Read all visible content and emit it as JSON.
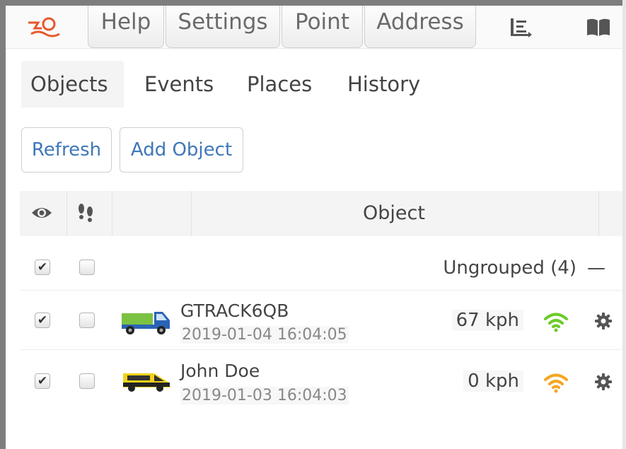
{
  "toolbar": {
    "logo_icon": "app-logo-icon",
    "buttons": [
      {
        "label": "Help"
      },
      {
        "label": "Settings"
      },
      {
        "label": "Point"
      },
      {
        "label": "Address"
      }
    ],
    "list_icon": "list-icon",
    "book_icon": "book-icon"
  },
  "tabs": [
    {
      "label": "Objects",
      "active": true
    },
    {
      "label": "Events"
    },
    {
      "label": "Places"
    },
    {
      "label": "History"
    }
  ],
  "actions": {
    "refresh_label": "Refresh",
    "add_object_label": "Add Object"
  },
  "table": {
    "visibility_icon": "eye-icon",
    "follow_icon": "footprints-icon",
    "object_header": "Object"
  },
  "group": {
    "label": "Ungrouped (4)",
    "collapse_symbol": "—",
    "visible_checked": true,
    "follow_checked": false
  },
  "objects": [
    {
      "name": "GTRACK6QB",
      "timestamp": "2019-01-04 16:04:05",
      "speed": "67 kph",
      "vehicle_icon": "truck-icon",
      "signal_icon": "wifi-signal-icon",
      "signal_color": "#6ccb2a",
      "visible_checked": true,
      "follow_checked": false
    },
    {
      "name": "John Doe",
      "timestamp": "2019-01-03 16:04:03",
      "speed": "0 kph",
      "vehicle_icon": "van-icon",
      "signal_icon": "wifi-signal-icon",
      "signal_color": "#f5a623",
      "visible_checked": true,
      "follow_checked": false
    }
  ],
  "colors": {
    "link_blue": "#3f77b9",
    "logo_orange": "#e8572a"
  }
}
